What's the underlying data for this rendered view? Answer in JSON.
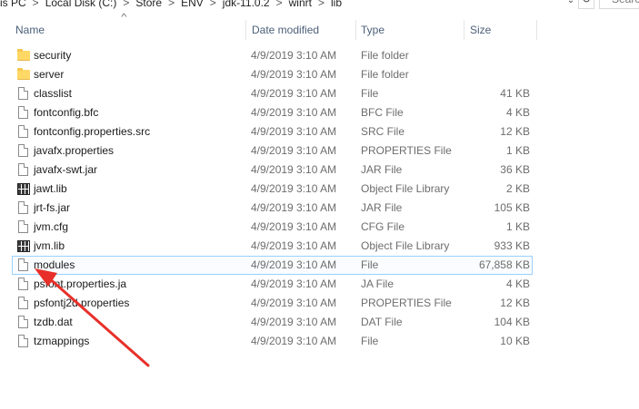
{
  "address_bar": {
    "crumbs": [
      "is PC",
      "Local Disk (C:)",
      "Store",
      "ENV",
      "jdk-11.0.2",
      "winrt",
      "lib"
    ],
    "separator": ">",
    "dropdown_glyph": "⌄",
    "refresh_glyph": "↻",
    "search_placeholder": "Search"
  },
  "columns": {
    "name": "Name",
    "date": "Date modified",
    "type": "Type",
    "size": "Size"
  },
  "files": [
    {
      "name": "security",
      "date": "4/9/2019 3:10 AM",
      "type": "File folder",
      "size": "",
      "icon": "folder"
    },
    {
      "name": "server",
      "date": "4/9/2019 3:10 AM",
      "type": "File folder",
      "size": "",
      "icon": "folder"
    },
    {
      "name": "classlist",
      "date": "4/9/2019 3:10 AM",
      "type": "File",
      "size": "41 KB",
      "icon": "file"
    },
    {
      "name": "fontconfig.bfc",
      "date": "4/9/2019 3:10 AM",
      "type": "BFC File",
      "size": "4 KB",
      "icon": "file"
    },
    {
      "name": "fontconfig.properties.src",
      "date": "4/9/2019 3:10 AM",
      "type": "SRC File",
      "size": "12 KB",
      "icon": "file"
    },
    {
      "name": "javafx.properties",
      "date": "4/9/2019 3:10 AM",
      "type": "PROPERTIES File",
      "size": "1 KB",
      "icon": "file"
    },
    {
      "name": "javafx-swt.jar",
      "date": "4/9/2019 3:10 AM",
      "type": "JAR File",
      "size": "36 KB",
      "icon": "file"
    },
    {
      "name": "jawt.lib",
      "date": "4/9/2019 3:10 AM",
      "type": "Object File Library",
      "size": "2 KB",
      "icon": "library"
    },
    {
      "name": "jrt-fs.jar",
      "date": "4/9/2019 3:10 AM",
      "type": "JAR File",
      "size": "105 KB",
      "icon": "file"
    },
    {
      "name": "jvm.cfg",
      "date": "4/9/2019 3:10 AM",
      "type": "CFG File",
      "size": "1 KB",
      "icon": "file"
    },
    {
      "name": "jvm.lib",
      "date": "4/9/2019 3:10 AM",
      "type": "Object File Library",
      "size": "933 KB",
      "icon": "library"
    },
    {
      "name": "modules",
      "date": "4/9/2019 3:10 AM",
      "type": "File",
      "size": "67,858 KB",
      "icon": "file",
      "selected": true
    },
    {
      "name": "psfont.properties.ja",
      "date": "4/9/2019 3:10 AM",
      "type": "JA File",
      "size": "4 KB",
      "icon": "file"
    },
    {
      "name": "psfontj2d.properties",
      "date": "4/9/2019 3:10 AM",
      "type": "PROPERTIES File",
      "size": "12 KB",
      "icon": "file"
    },
    {
      "name": "tzdb.dat",
      "date": "4/9/2019 3:10 AM",
      "type": "DAT File",
      "size": "104 KB",
      "icon": "file"
    },
    {
      "name": "tzmappings",
      "date": "4/9/2019 3:10 AM",
      "type": "File",
      "size": "10 KB",
      "icon": "file"
    }
  ],
  "colors": {
    "header_text": "#4c607a",
    "selection_border": "#99d1ff",
    "annotation_arrow": "#e8302a",
    "folder": "#ffd866"
  }
}
